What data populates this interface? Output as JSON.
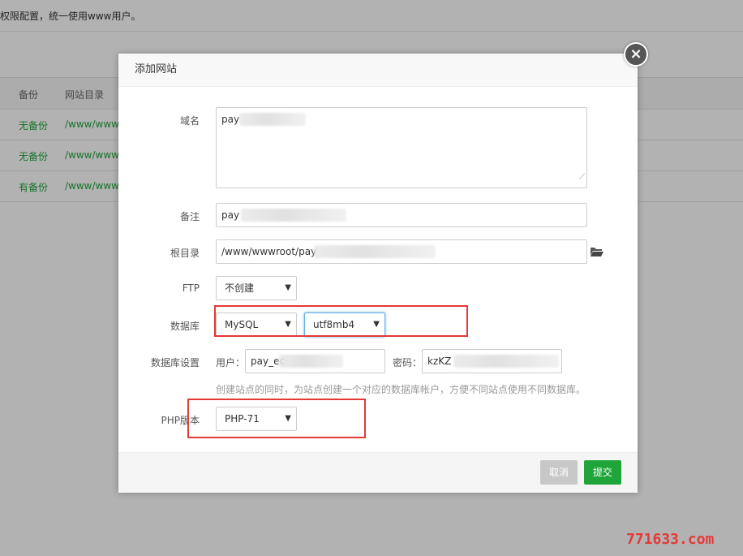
{
  "background": {
    "notice": "权限配置，统一使用www用户。",
    "table_headers": [
      "备份",
      "网站目录"
    ],
    "rows": [
      {
        "backup": "无备份",
        "dir": "/www/www"
      },
      {
        "backup": "无备份",
        "dir": "/www/www"
      },
      {
        "backup": "有备份",
        "dir": "/www/www"
      }
    ]
  },
  "modal": {
    "title": "添加网站",
    "close_icon": "close-icon",
    "domain_label": "域名",
    "domain_value": "pay",
    "remark_label": "备注",
    "remark_value": "pay",
    "root_label": "根目录",
    "root_value": "/www/wwwroot/pay",
    "root_icon": "folder-open-icon",
    "ftp_label": "FTP",
    "ftp_value": "不创建",
    "db_label": "数据库",
    "db_type_value": "MySQL",
    "db_charset_value": "utf8mb4",
    "db_settings_label": "数据库设置",
    "db_user_label": "用户：",
    "db_user_value": "pay_ec",
    "db_pass_label": "密码：",
    "db_pass_value": "kzKZ",
    "db_hint": "创建站点的同时，为站点创建一个对应的数据库帐户，方便不同站点使用不同数据库。",
    "php_label": "PHP版本",
    "php_value": "PHP-71",
    "cancel_label": "取消",
    "submit_label": "提交"
  },
  "colors": {
    "accent": "#20a53a",
    "highlight": "#e53935"
  },
  "watermark": "771633.com"
}
